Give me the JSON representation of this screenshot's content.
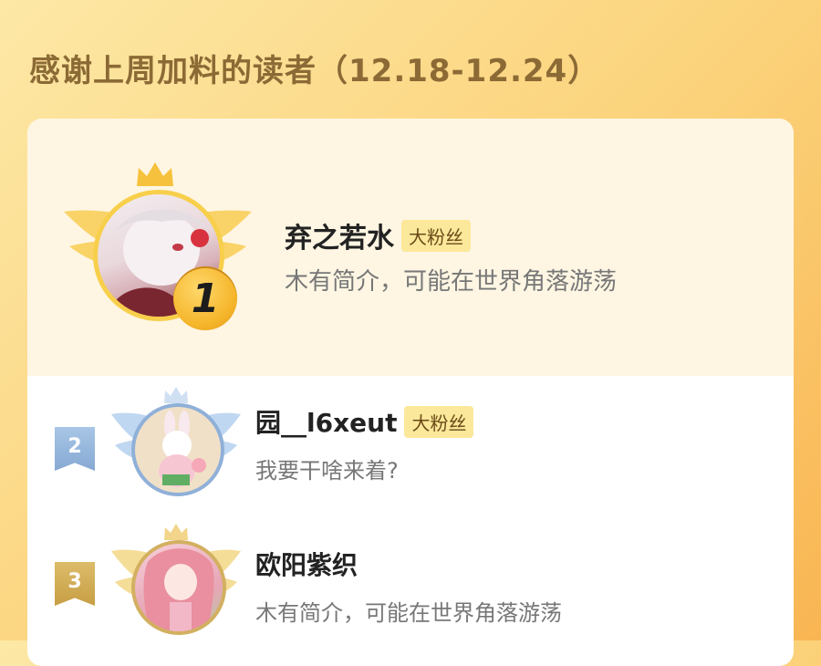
{
  "header": {
    "title": "感谢上周加料的读者（12.18-12.24）"
  },
  "readers": [
    {
      "rank": "1",
      "name": "弃之若水",
      "badge": "大粉丝",
      "bio": "木有简介，可能在世界角落游荡"
    },
    {
      "rank": "2",
      "name": "园__l6xeut",
      "badge": "大粉丝",
      "bio": "我要干啥来着?"
    },
    {
      "rank": "3",
      "name": "欧阳紫织",
      "bio": "木有简介，可能在世界角落游荡"
    }
  ],
  "colors": {
    "background": "#fbd27a",
    "title": "#8c6a35",
    "badge_bg": "#fbe89a",
    "gold": "#f5b52a",
    "silver": "#9fc0e4",
    "bronze": "#d8b35a"
  }
}
